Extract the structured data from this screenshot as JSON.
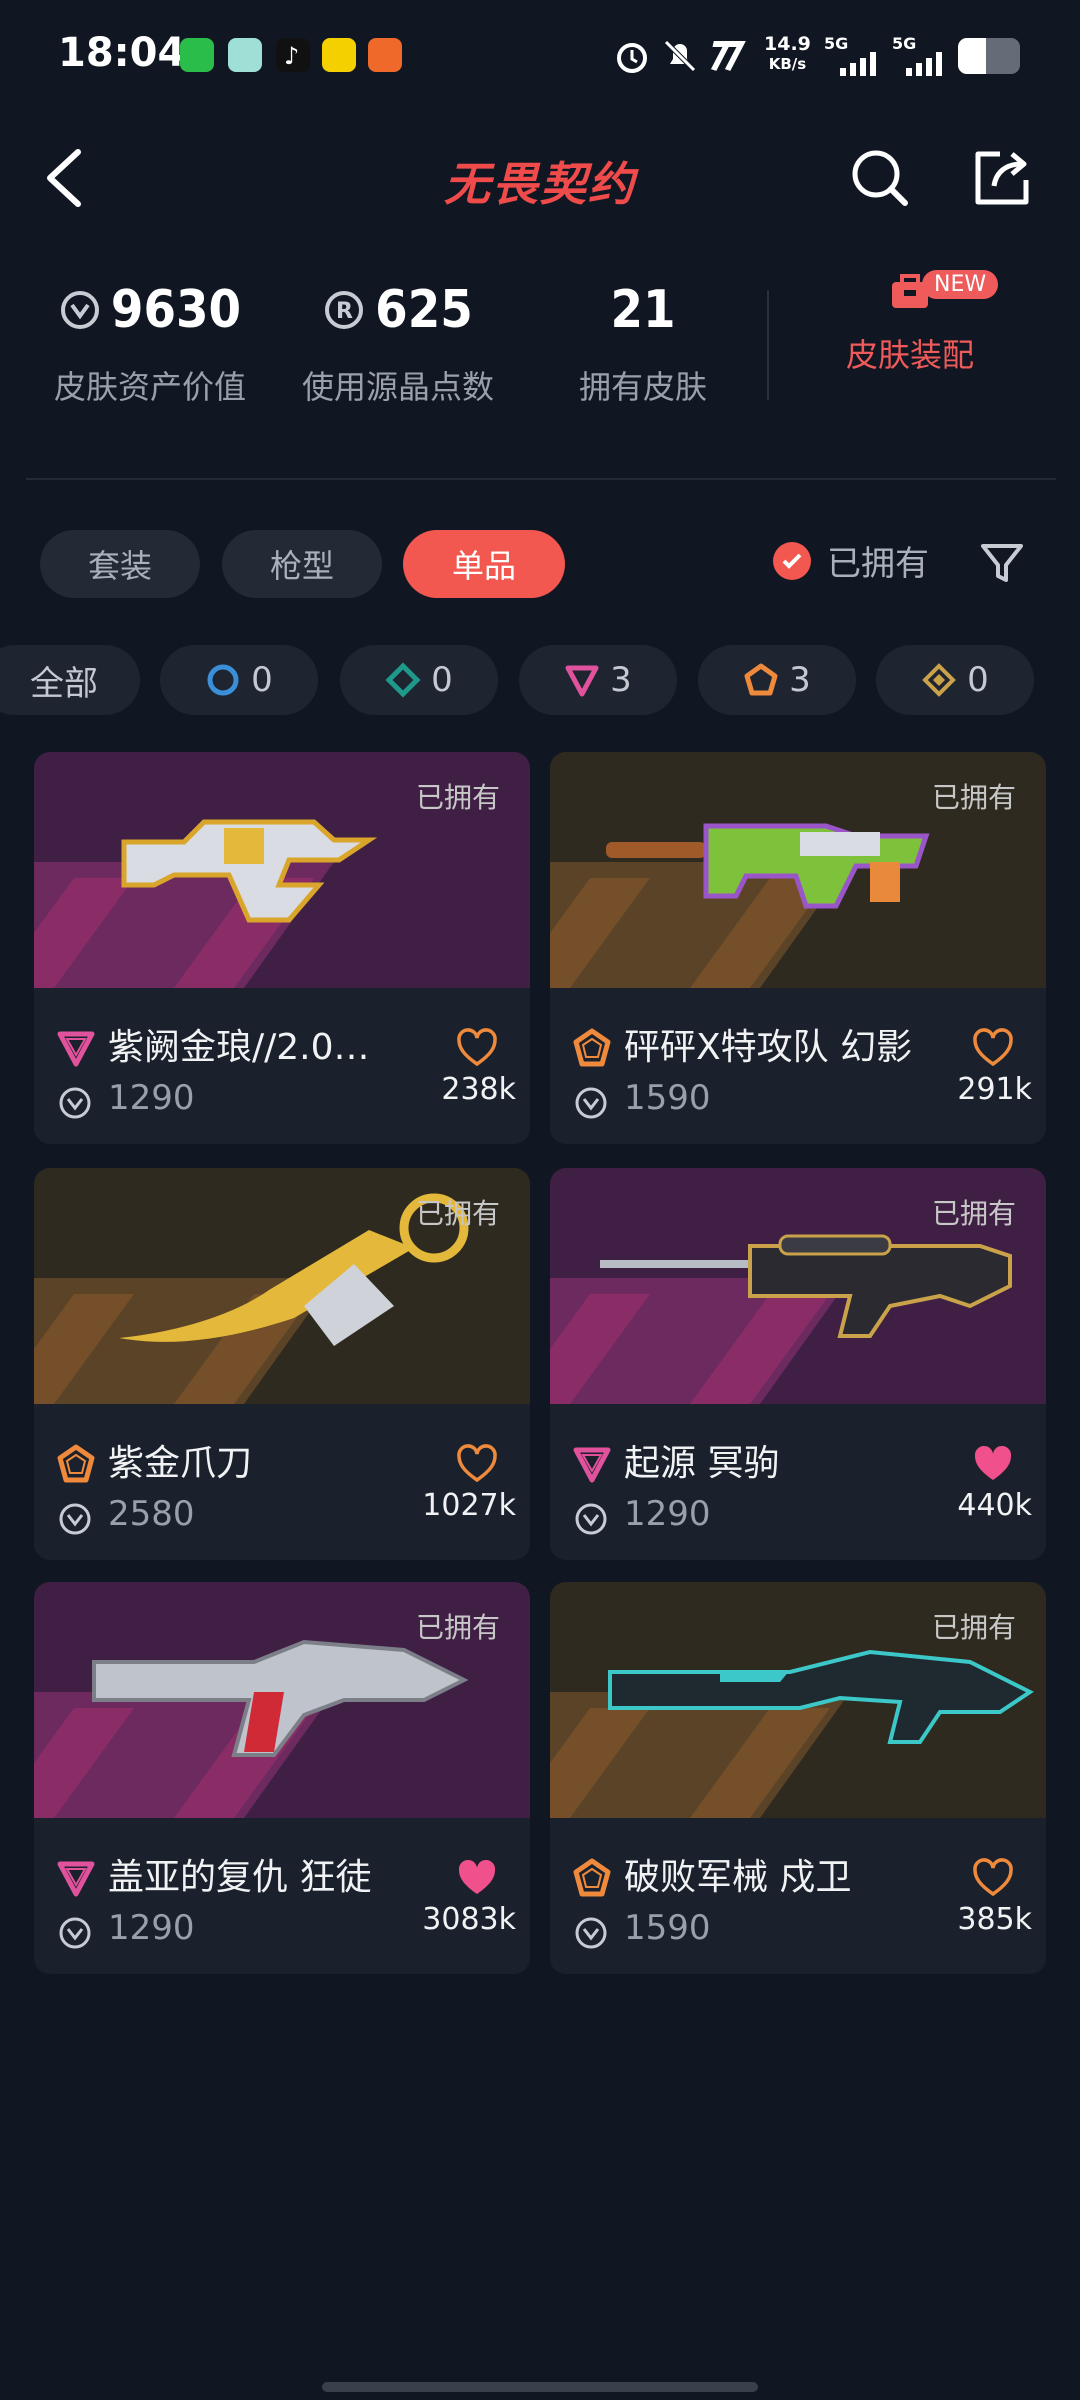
{
  "status_bar": {
    "time": "18:04",
    "net_speed": "14.9",
    "net_unit": "KB/s",
    "sim1": "5G",
    "sim2": "5G",
    "battery_percent": 45
  },
  "header": {
    "title": "无畏契约",
    "back_icon": "chevron-left-icon",
    "search_icon": "search-icon",
    "share_icon": "share-icon"
  },
  "stats": [
    {
      "value": "9630",
      "label": "皮肤资产价值",
      "icon": "vp-coin-icon"
    },
    {
      "value": "625",
      "label": "使用源晶点数",
      "icon": "radianite-icon"
    },
    {
      "value": "21",
      "label": "拥有皮肤"
    }
  ],
  "outfit": {
    "label": "皮肤装配",
    "badge": "NEW"
  },
  "category_tabs": [
    {
      "label": "套装",
      "active": false
    },
    {
      "label": "枪型",
      "active": false
    },
    {
      "label": "单品",
      "active": true
    }
  ],
  "owned_filter": {
    "label": "已拥有",
    "checked": true
  },
  "rarity_chips": [
    {
      "label": "全部",
      "count": ""
    },
    {
      "label": "",
      "count": "0",
      "color": "#3b8fd9",
      "icon": "select-tier-icon"
    },
    {
      "label": "",
      "count": "0",
      "color": "#1f9a8a",
      "icon": "deluxe-tier-icon"
    },
    {
      "label": "",
      "count": "3",
      "color": "#e0529c",
      "icon": "premium-tier-icon"
    },
    {
      "label": "",
      "count": "3",
      "color": "#ef8a3c",
      "icon": "exclusive-tier-icon"
    },
    {
      "label": "",
      "count": "0",
      "color": "#c9a24a",
      "icon": "ultra-tier-icon"
    }
  ],
  "cards": [
    {
      "owned": "已拥有",
      "name": "紫阙金琅//2.0…",
      "price": "1290",
      "likes": "238k",
      "tier": "premium",
      "liked": false,
      "bg": "purple"
    },
    {
      "owned": "已拥有",
      "name": "砰砰X特攻队 幻影",
      "price": "1590",
      "likes": "291k",
      "tier": "exclusive",
      "liked": false,
      "bg": "brown"
    },
    {
      "owned": "已拥有",
      "name": "紫金爪刀",
      "price": "2580",
      "likes": "1027k",
      "tier": "exclusive",
      "liked": false,
      "bg": "brown"
    },
    {
      "owned": "已拥有",
      "name": "起源 冥驹",
      "price": "1290",
      "likes": "440k",
      "tier": "premium",
      "liked": true,
      "bg": "purple"
    },
    {
      "owned": "已拥有",
      "name": "盖亚的复仇 狂徒",
      "price": "1290",
      "likes": "3083k",
      "tier": "premium",
      "liked": true,
      "bg": "purple"
    },
    {
      "owned": "已拥有",
      "name": "破败军械 戍卫",
      "price": "1590",
      "likes": "385k",
      "tier": "exclusive",
      "liked": false,
      "bg": "brown"
    }
  ],
  "colors": {
    "accent": "#f2584f",
    "premium": "#e0529c",
    "exclusive": "#ef8a3c"
  }
}
